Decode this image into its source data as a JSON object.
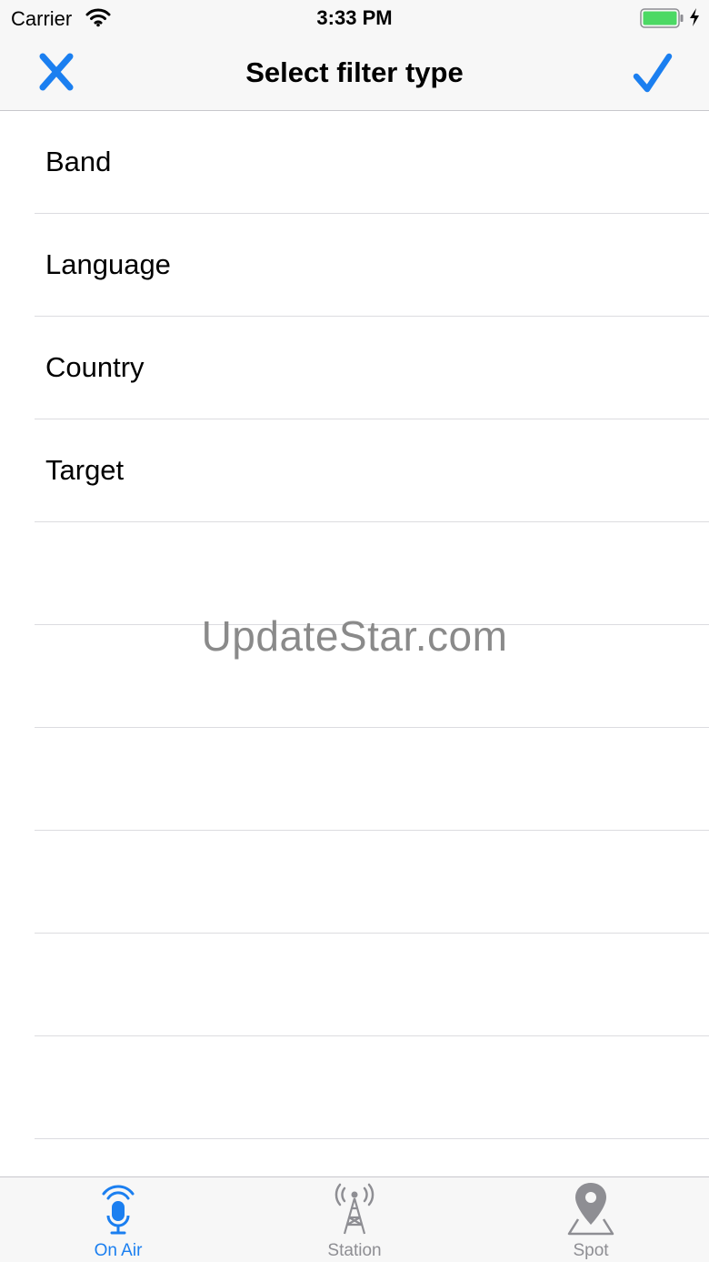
{
  "status_bar": {
    "carrier": "Carrier",
    "time": "3:33 PM",
    "wifi_icon": "wifi-icon",
    "battery_icon": "battery-charging-icon"
  },
  "nav": {
    "title": "Select filter type",
    "close_icon": "close-icon",
    "confirm_icon": "checkmark-icon",
    "accent_color": "#1b7ff0"
  },
  "filter_types": [
    {
      "label": "Band"
    },
    {
      "label": "Language"
    },
    {
      "label": "Country"
    },
    {
      "label": "Target"
    }
  ],
  "watermark": "UpdateStar.com",
  "tabs": [
    {
      "label": "On Air",
      "icon": "microphone-broadcast-icon",
      "active": true
    },
    {
      "label": "Station",
      "icon": "radio-tower-icon",
      "active": false
    },
    {
      "label": "Spot",
      "icon": "map-pin-icon",
      "active": false
    }
  ]
}
